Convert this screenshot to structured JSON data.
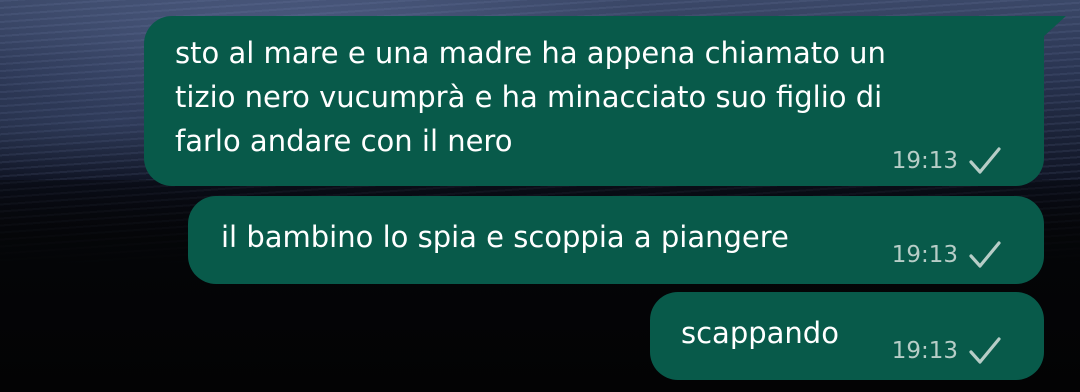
{
  "chat": {
    "messages": [
      {
        "lines": [
          "sto al mare e una madre ha appena chiamato un",
          "tizio nero vucumprà e ha minacciato suo figlio di",
          "farlo andare con il nero"
        ],
        "time": "19:13",
        "status_icon": "single-check-icon"
      },
      {
        "lines": [
          "il bambino lo spia e scoppia a piangere"
        ],
        "time": "19:13",
        "status_icon": "single-check-icon"
      },
      {
        "lines": [
          "scappando"
        ],
        "time": "19:13",
        "status_icon": "single-check-icon"
      }
    ]
  },
  "colors": {
    "outgoing_bubble": "#085a4a",
    "text": "#ffffff",
    "meta": "#b7cdc7"
  }
}
